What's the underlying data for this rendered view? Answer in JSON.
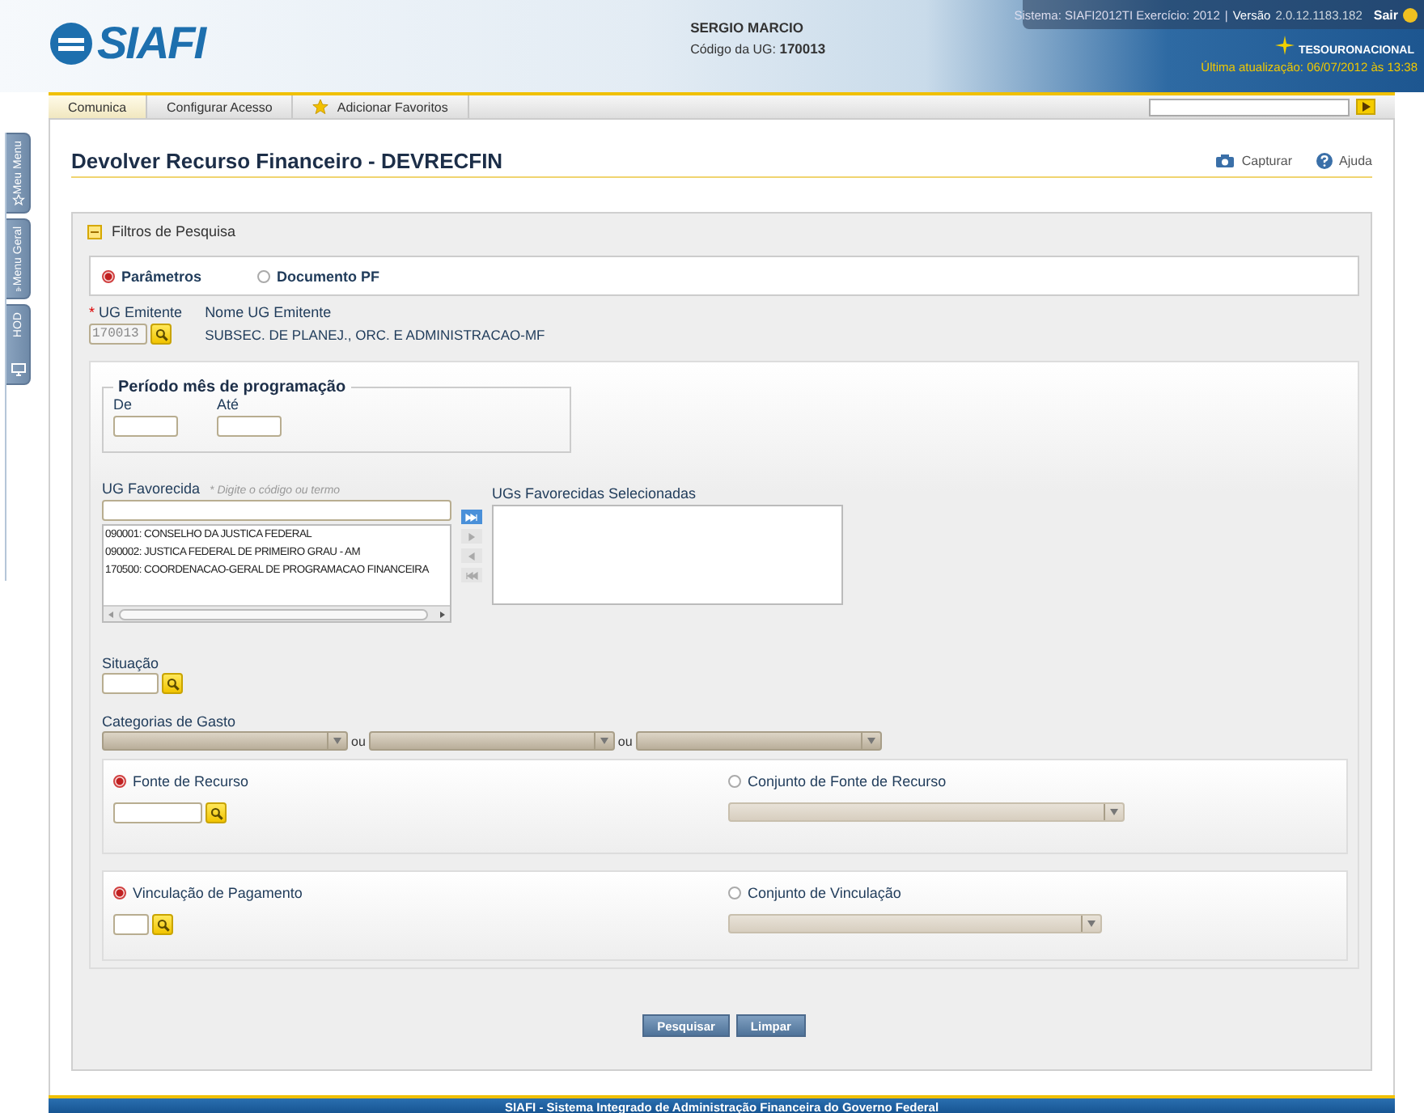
{
  "header": {
    "logo_text": "SIAFI",
    "user_name": "SERGIO MARCIO",
    "ug_label": "Código da UG:",
    "ug_code": "170013",
    "system_info": "Sistema: SIAFI2012TI Exercício: 2012",
    "separator": "|",
    "version_label": "Versão",
    "version": "2.0.12.1183.182",
    "logout": "Sair",
    "agency": "TESOURONACIONAL",
    "last_update": "Última atualização: 06/07/2012 às 13:38"
  },
  "nav": {
    "tabs": [
      {
        "label": "Comunica",
        "selected": true
      },
      {
        "label": "Configurar Acesso",
        "selected": false
      },
      {
        "label": "Adicionar Favoritos",
        "selected": false
      }
    ]
  },
  "side_tabs": [
    {
      "label": "Meu Menu",
      "kind": "star"
    },
    {
      "label": "Menu Geral",
      "kind": "tree"
    },
    {
      "label": "HOD",
      "kind": "monitor"
    }
  ],
  "page": {
    "title": "Devolver Recurso Financeiro - DEVRECFIN",
    "actions": [
      {
        "label": "Capturar",
        "kind": "camera"
      },
      {
        "label": "Ajuda",
        "kind": "help"
      }
    ]
  },
  "filters": {
    "title": "Filtros de Pesquisa",
    "expanded": true,
    "mode": [
      {
        "label": "Parâmetros",
        "selected": true
      },
      {
        "label": "Documento PF",
        "selected": false
      }
    ],
    "ug_emitente": {
      "required_mark": "*",
      "label": "UG Emitente",
      "value": "170013",
      "disabled": true
    },
    "nome_ug": {
      "label": "Nome UG Emitente",
      "value": "SUBSEC. DE PLANEJ., ORC. E ADMINISTRACAO-MF"
    },
    "periodo": {
      "legend": "Período mês de programação",
      "from_label": "De",
      "to_label": "Até"
    },
    "ug_favorecida": {
      "label": "UG Favorecida",
      "hint": "* Digite o código ou termo",
      "options": [
        "090001: CONSELHO DA JUSTICA FEDERAL",
        "090002: JUSTICA FEDERAL DE PRIMEIRO GRAU - AM",
        "170500: COORDENACAO-GERAL DE PROGRAMACAO FINANCEIRA"
      ]
    },
    "transfer_buttons": [
      {
        "kind": "add-all",
        "disabled": false
      },
      {
        "kind": "add",
        "disabled": true
      },
      {
        "kind": "remove",
        "disabled": true
      },
      {
        "kind": "remove-all",
        "disabled": true
      }
    ],
    "selecionadas": {
      "label": "UGs Favorecidas Selecionadas"
    },
    "situacao": {
      "label": "Situação"
    },
    "categorias": {
      "label": "Categorias de Gasto",
      "separators": [
        "ou",
        "ou"
      ]
    },
    "fonte": [
      {
        "label": "Fonte de Recurso",
        "selected": true
      },
      {
        "label": "Conjunto de Fonte de Recurso",
        "selected": false
      }
    ],
    "vinculacao": [
      {
        "label": "Vinculação de Pagamento",
        "selected": true
      },
      {
        "label": "Conjunto de Vinculação",
        "selected": false
      }
    ]
  },
  "buttons": [
    "Pesquisar",
    "Limpar"
  ],
  "footer": "SIAFI - Sistema Integrado de Administração Financeira do Governo Federal"
}
